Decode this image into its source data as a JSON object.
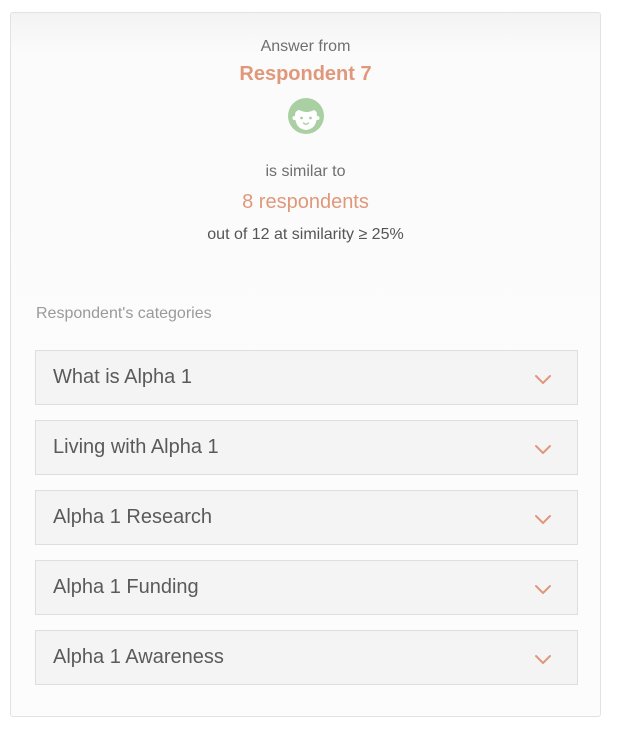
{
  "header": {
    "answer_from_label": "Answer from",
    "respondent_name": "Respondent 7",
    "avatar_icon": "boy-face-icon",
    "is_similar_to_label": "is similar to",
    "similar_count": "8 respondents",
    "similarity_text": "out of 12 at similarity ≥ 25%"
  },
  "categories": {
    "title": "Respondent's categories",
    "items": [
      {
        "label": "What is Alpha 1",
        "icon": "chevron-down-icon"
      },
      {
        "label": "Living with Alpha 1",
        "icon": "chevron-down-icon"
      },
      {
        "label": "Alpha 1 Research",
        "icon": "chevron-down-icon"
      },
      {
        "label": "Alpha 1 Funding",
        "icon": "chevron-down-icon"
      },
      {
        "label": "Alpha 1 Awareness",
        "icon": "chevron-down-icon"
      }
    ]
  },
  "colors": {
    "accent": "#e0987a",
    "avatar": "#a9cfa3"
  }
}
